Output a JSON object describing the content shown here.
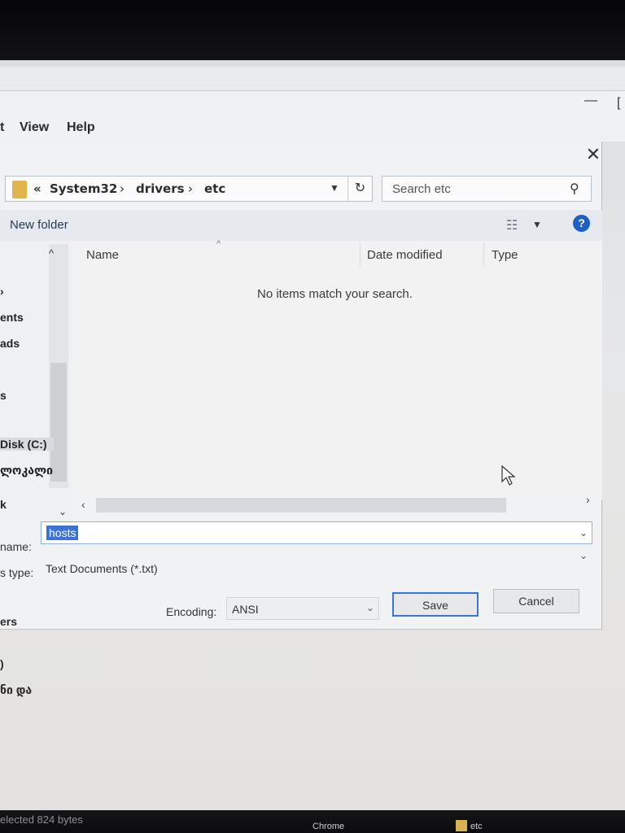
{
  "notepad": {
    "menu": [
      "t",
      "View",
      "Help"
    ],
    "minimize": "—"
  },
  "dialog": {
    "close": "✕",
    "breadcrumb": {
      "prefix": "«",
      "parts": [
        "System32",
        "drivers",
        "etc"
      ],
      "separator": "›"
    },
    "search_placeholder": "Search etc",
    "toolbar": {
      "new_folder": "New folder",
      "help": "?"
    },
    "nav_items": [
      "ents",
      "ads",
      "s",
      "Disk (C:)",
      "ლოკალი",
      "k"
    ],
    "columns": [
      "Name",
      "Date modified",
      "Type"
    ],
    "empty_message": "No items match your search.",
    "filename_label": "name:",
    "filename_value": "hosts",
    "type_label": "s type:",
    "type_value": "Text Documents (*.txt)",
    "encoding_label": "Encoding:",
    "encoding_value": "ANSI",
    "save_label": "Save",
    "cancel_label": "Cancel",
    "nav_footer": "ers"
  },
  "background": {
    "lines": [
      ")",
      "ნი და"
    ]
  },
  "status_bar": "elected  824 bytes",
  "taskbar": [
    "Chrome",
    "etc"
  ],
  "colors": {
    "selection": "#3c74d4",
    "help_icon": "#1f5fc2",
    "folder": "#e0b54c"
  }
}
